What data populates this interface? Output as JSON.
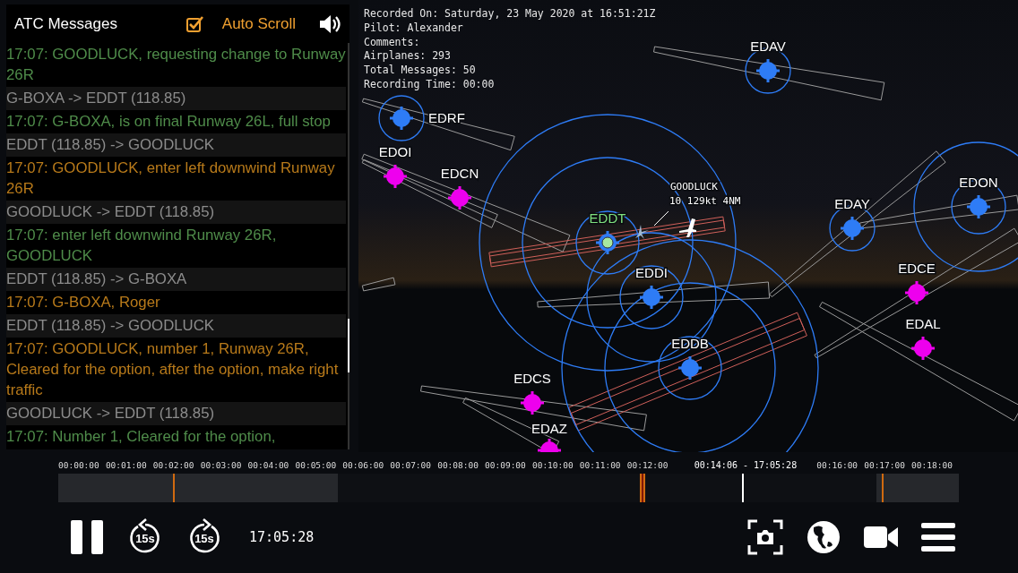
{
  "atc_panel": {
    "title": "ATC Messages",
    "auto_scroll": {
      "label": "Auto Scroll",
      "checked": true
    },
    "messages": [
      {
        "kind": "pilot",
        "text": "17:07: GOODLUCK, requesting change to Runway 26R"
      },
      {
        "kind": "route",
        "text": "G-BOXA -> EDDT (118.85)"
      },
      {
        "kind": "pilot",
        "text": "17:07: G-BOXA, is on final Runway 26L, full stop"
      },
      {
        "kind": "route",
        "text": "EDDT (118.85) -> GOODLUCK"
      },
      {
        "kind": "atc",
        "text": "17:07: GOODLUCK, enter left downwind Runway 26R"
      },
      {
        "kind": "route",
        "text": "GOODLUCK -> EDDT (118.85)"
      },
      {
        "kind": "pilot",
        "text": "17:07: enter left downwind Runway 26R, GOODLUCK"
      },
      {
        "kind": "route",
        "text": "EDDT (118.85) -> G-BOXA"
      },
      {
        "kind": "atc",
        "text": "17:07: G-BOXA, Roger"
      },
      {
        "kind": "route",
        "text": "EDDT (118.85) -> GOODLUCK"
      },
      {
        "kind": "atc",
        "text": "17:07: GOODLUCK, number 1, Runway 26R, Cleared for the option, after the option, make right traffic"
      },
      {
        "kind": "route",
        "text": "GOODLUCK -> EDDT (118.85)"
      },
      {
        "kind": "pilot",
        "text": "17:07: Number 1, Cleared for the option,"
      }
    ]
  },
  "recording_info": [
    "Recorded On: Saturday, 23 May 2020 at 16:51:21Z",
    "Pilot: Alexander",
    "Comments:",
    "Airplanes: 293",
    "Total Messages: 50",
    "Recording Time: 00:00"
  ],
  "map": {
    "airports": [
      {
        "code": "EDRF",
        "color": "#2e7cf6",
        "highlighted": false
      },
      {
        "code": "EDAV",
        "color": "#2e7cf6",
        "highlighted": false
      },
      {
        "code": "EDOI",
        "color": "#ee00ee",
        "highlighted": false
      },
      {
        "code": "EDCN",
        "color": "#ee00ee",
        "highlighted": false
      },
      {
        "code": "EDDT",
        "color": "#2e7cf6",
        "highlighted": true
      },
      {
        "code": "EDDI",
        "color": "#2e7cf6",
        "highlighted": false
      },
      {
        "code": "EDAY",
        "color": "#2e7cf6",
        "highlighted": false
      },
      {
        "code": "EDON",
        "color": "#2e7cf6",
        "highlighted": false
      },
      {
        "code": "EDCE",
        "color": "#ee00ee",
        "highlighted": false
      },
      {
        "code": "EDAL",
        "color": "#ee00ee",
        "highlighted": false
      },
      {
        "code": "EDDB",
        "color": "#2e7cf6",
        "highlighted": false
      },
      {
        "code": "EDCS",
        "color": "#ee00ee",
        "highlighted": false
      },
      {
        "code": "EDAZ",
        "color": "#ee00ee",
        "highlighted": false
      }
    ],
    "aircraft": {
      "callsign": "GOODLUCK",
      "readout": "10 129kt 4NM"
    }
  },
  "timeline": {
    "ticks": [
      "00:00:00",
      "00:01:00",
      "00:02:00",
      "00:03:00",
      "00:04:00",
      "00:05:00",
      "00:06:00",
      "00:07:00",
      "00:08:00",
      "00:09:00",
      "00:10:00",
      "00:11:00",
      "00:12:00",
      "00:16:00",
      "00:17:00",
      "00:18:00"
    ],
    "cursor_label": "00:14:06 - 17:05:28",
    "level": 0.76
  },
  "player": {
    "playing": true,
    "rewind_label": "15s",
    "forward_label": "15s",
    "time": "17:05:28"
  }
}
